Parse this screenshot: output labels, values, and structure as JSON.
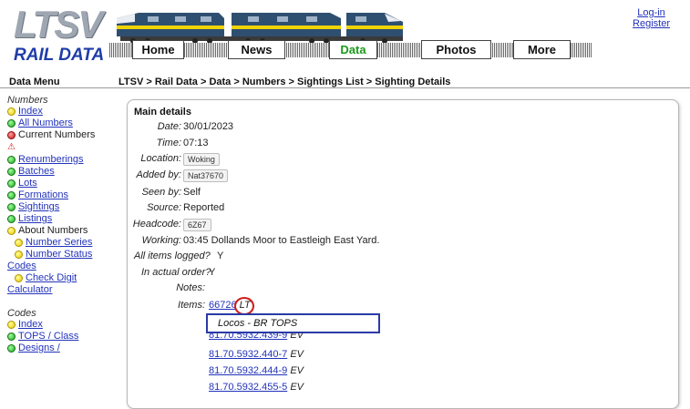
{
  "header": {
    "logo_letters": "LTSV",
    "logo_text": "RAIL DATA",
    "nav": [
      "Home",
      "News",
      "Data",
      "Photos",
      "More"
    ],
    "active_nav": "Data",
    "login": "Log-in",
    "register": "Register"
  },
  "menu_heading": "Data Menu",
  "breadcrumb": "LTSV > Rail Data > Data > Numbers > Sightings List > Sighting Details",
  "sidebar": {
    "numbers_heading": "Numbers",
    "index": "Index",
    "all_numbers": "All Numbers",
    "current_numbers": "Current Numbers",
    "renumberings": "Renumberings",
    "batches": "Batches",
    "lots": "Lots",
    "formations": "Formations",
    "sightings": "Sightings",
    "listings": "Listings",
    "about_numbers": "About Numbers",
    "number_series": "Number Series",
    "number_status": "Number Status",
    "codes_link": "Codes",
    "check_digit_a": "Check Digit",
    "check_digit_b": "Calculator",
    "codes_heading": "Codes",
    "codes_index": "Index",
    "tops_class": "TOPS / Class",
    "designs": "Designs /"
  },
  "details": {
    "title": "Main details",
    "date_label": "Date:",
    "date": "30/01/2023",
    "time_label": "Time:",
    "time": "07:13",
    "location_label": "Location:",
    "location": "Woking",
    "added_by_label": "Added by:",
    "added_by": "Nat37670",
    "seen_by_label": "Seen by:",
    "seen_by": "Self",
    "source_label": "Source:",
    "source": "Reported",
    "headcode_label": "Headcode:",
    "headcode": "6Z67",
    "working_label": "Working:",
    "working": "03:45 Dollands Moor to Eastleigh East Yard.",
    "all_logged_label": "All items logged?",
    "all_logged": "Y",
    "actual_order_label": "In actual order?",
    "actual_order": "Y",
    "notes_label": "Notes:",
    "items_label": "Items:",
    "first_item": "66726",
    "first_item_code": "LT",
    "tooltip": "Locos - BR TOPS",
    "items": [
      {
        "number": "81.70.5932.439-9",
        "code": "EV"
      },
      {
        "number": "81.70.5932.440-7",
        "code": "EV"
      },
      {
        "number": "81.70.5932.444-9",
        "code": "EV"
      },
      {
        "number": "81.70.5932.455-5",
        "code": "EV"
      }
    ]
  },
  "colors": {
    "link": "#2233bb",
    "active_nav": "#1a9a1a",
    "logo_blue": "#1f3da8",
    "highlight_circle": "#d01a1a",
    "tooltip_border": "#2a3aa6"
  }
}
